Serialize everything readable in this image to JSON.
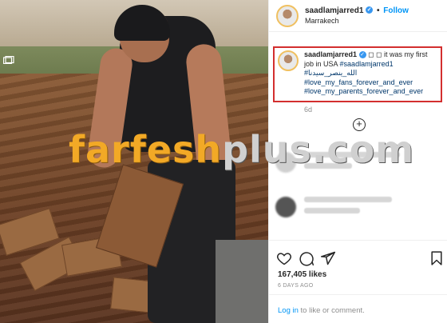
{
  "post": {
    "username": "saadlamjarred1",
    "location": "Marrakech",
    "follow_label": "Follow",
    "dot": "•",
    "verified_mark": "✓"
  },
  "caption": {
    "username": "saadlamjarred1",
    "text": "◻ ◻ it was my first job in USA",
    "hashtags": [
      "#saadlamjarred1",
      "#الله_ينصر_سيدنا",
      "#love_my_fans_forever_and_ever",
      "#love_my_parents_forever_and_ever"
    ],
    "age": "6d"
  },
  "watermark": {
    "main": "farfesh",
    "plus": "plus",
    "com": ".com"
  },
  "actions": {
    "likes": "167,405 likes",
    "date": "6 DAYS AGO"
  },
  "login": {
    "link": "Log in",
    "rest": " to like or comment."
  },
  "icons": [
    "heart-icon",
    "comment-icon",
    "share-icon",
    "bookmark-icon",
    "add-icon",
    "verified-icon"
  ],
  "colors": {
    "accent": "#0095f6",
    "highlight_border": "#d32f2f",
    "watermark": "#f2a926"
  }
}
